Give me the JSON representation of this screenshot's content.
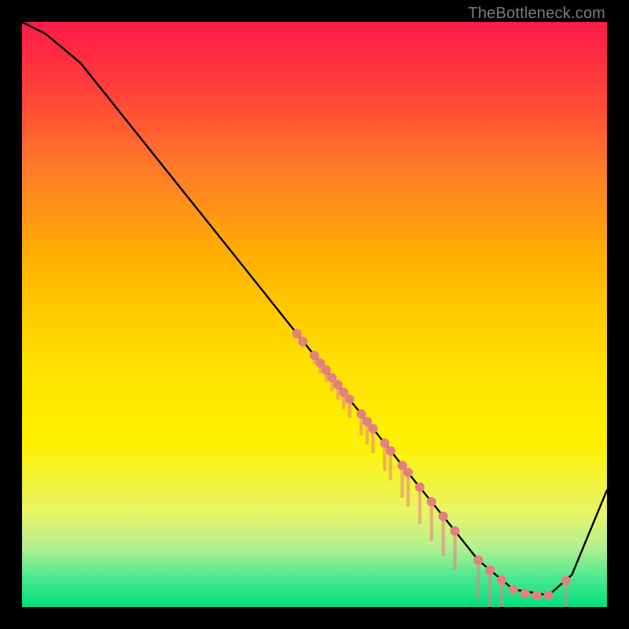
{
  "attribution": "TheBottleneck.com",
  "chart_data": {
    "type": "line",
    "title": "",
    "xlabel": "",
    "ylabel": "",
    "xlim": [
      0,
      100
    ],
    "ylim": [
      0,
      100
    ],
    "curve": {
      "name": "bottleneck-curve",
      "x": [
        0,
        4,
        10,
        20,
        30,
        40,
        47,
        50,
        55,
        60,
        65,
        72,
        78,
        84,
        90,
        94,
        100
      ],
      "y": [
        100,
        98,
        93,
        80.5,
        68,
        55.5,
        46.7,
        43,
        36.7,
        30.5,
        24.2,
        15.5,
        8,
        3,
        2,
        5.5,
        20
      ]
    },
    "highlight_points": {
      "name": "highlight-markers",
      "color": "#e38080",
      "points": [
        {
          "x": 47,
          "y": 46.7
        },
        {
          "x": 48,
          "y": 45.4
        },
        {
          "x": 50,
          "y": 43
        },
        {
          "x": 51,
          "y": 41.7
        },
        {
          "x": 52,
          "y": 40.5
        },
        {
          "x": 53,
          "y": 39.2
        },
        {
          "x": 54,
          "y": 38
        },
        {
          "x": 55,
          "y": 36.7
        },
        {
          "x": 56,
          "y": 35.5
        },
        {
          "x": 58,
          "y": 33
        },
        {
          "x": 59,
          "y": 31.7
        },
        {
          "x": 60,
          "y": 30.5
        },
        {
          "x": 62,
          "y": 28
        },
        {
          "x": 63,
          "y": 26.7
        },
        {
          "x": 65,
          "y": 24.2
        },
        {
          "x": 66,
          "y": 23
        },
        {
          "x": 68,
          "y": 20.5
        },
        {
          "x": 70,
          "y": 18
        },
        {
          "x": 72,
          "y": 15.5
        },
        {
          "x": 74,
          "y": 13
        },
        {
          "x": 78,
          "y": 8
        },
        {
          "x": 80,
          "y": 6.3
        },
        {
          "x": 82,
          "y": 4.6
        },
        {
          "x": 84,
          "y": 3
        },
        {
          "x": 86,
          "y": 2.3
        },
        {
          "x": 88,
          "y": 2
        },
        {
          "x": 90,
          "y": 2
        },
        {
          "x": 93,
          "y": 4.5
        }
      ]
    }
  }
}
